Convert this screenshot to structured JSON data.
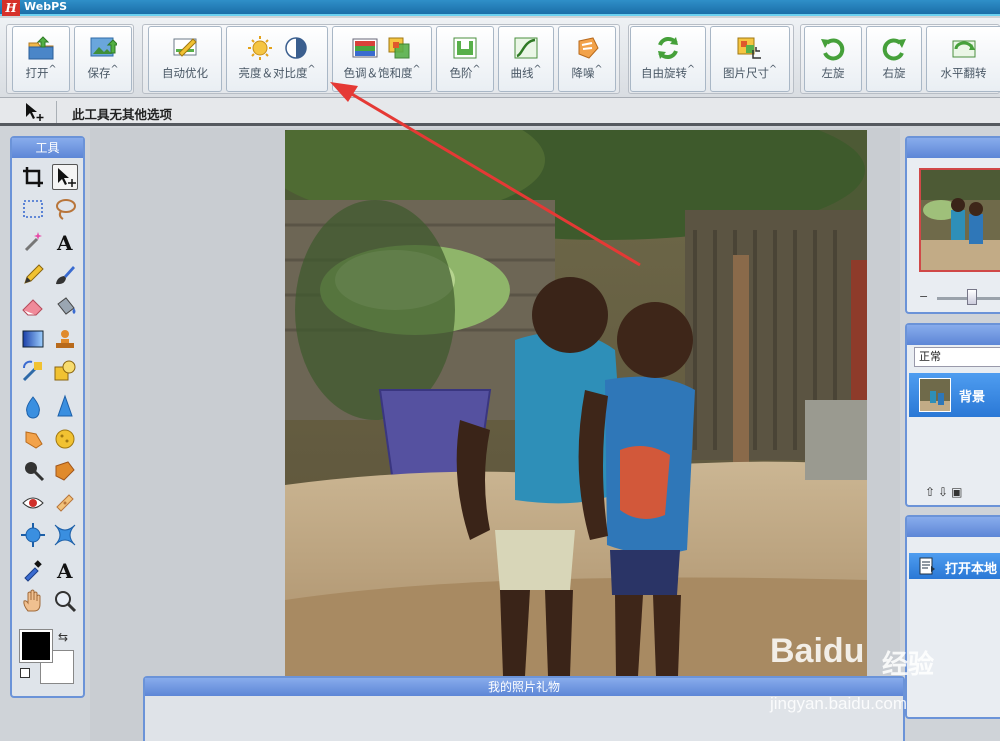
{
  "app": {
    "title": "WebPS",
    "logo_glyph": "H"
  },
  "toolbar": {
    "open": "打开",
    "save": "保存",
    "auto_optimize": "自动优化",
    "brightness_contrast": "亮度＆对比度",
    "hue_saturation": "色调＆饱和度",
    "levels": "色阶",
    "curves": "曲线",
    "denoise": "降噪",
    "free_rotate": "自由旋转",
    "image_size": "图片尺寸",
    "rotate_left": "左旋",
    "rotate_right": "右旋",
    "flip_horizontal": "水平翻转",
    "dropdown_marker": "^"
  },
  "options_bar": {
    "message": "此工具无其他选项"
  },
  "tools_panel": {
    "title": "工具"
  },
  "layers_panel": {
    "blend_mode": "正常",
    "layer_name": "背景"
  },
  "history_panel": {
    "item": "打开本地"
  },
  "gift_panel": {
    "title": "我的照片礼物"
  },
  "watermark": {
    "brand": "Baidu",
    "brand_cn": "经验",
    "url": "jingyan.baidu.com"
  },
  "colors": {
    "accent": "#6b93d8",
    "annotation_arrow": "#e53935",
    "foreground": "#000000",
    "background": "#ffffff"
  }
}
